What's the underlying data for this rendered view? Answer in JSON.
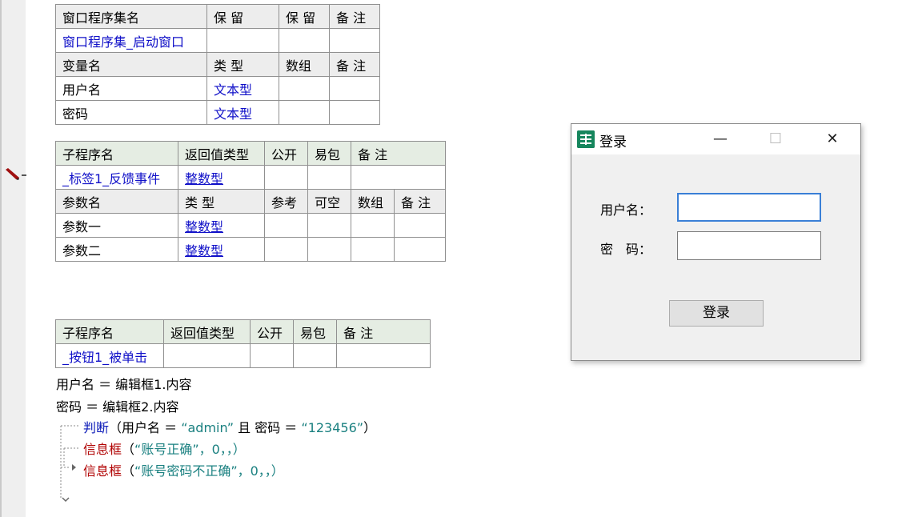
{
  "table1": {
    "header1": [
      "窗口程序集名",
      "保 留",
      "保 留",
      "备 注"
    ],
    "row1": [
      "窗口程序集_启动窗口",
      "",
      "",
      ""
    ],
    "header2": [
      "变量名",
      "类 型",
      "数组",
      "备 注"
    ],
    "vars": [
      [
        "用户名",
        "文本型",
        "",
        ""
      ],
      [
        "密码",
        "文本型",
        "",
        ""
      ]
    ]
  },
  "table2": {
    "header1": [
      "子程序名",
      "返回值类型",
      "公开",
      "易包",
      "备 注"
    ],
    "row1": [
      "_标签1_反馈事件",
      "整数型",
      "",
      "",
      ""
    ],
    "header2": [
      "参数名",
      "类 型",
      "参考",
      "可空",
      "数组",
      "备 注"
    ],
    "params": [
      [
        "参数一",
        "整数型",
        "",
        "",
        "",
        ""
      ],
      [
        "参数二",
        "整数型",
        "",
        "",
        "",
        ""
      ]
    ]
  },
  "table3": {
    "header1": [
      "子程序名",
      "返回值类型",
      "公开",
      "易包",
      "备 注"
    ],
    "row1": [
      "_按钮1_被单击",
      "",
      "",
      "",
      ""
    ]
  },
  "code": {
    "line1": "用户名 ＝ 编辑框1.内容",
    "line2": "密码 ＝ 编辑框2.内容",
    "if_kw": "判断",
    "if_cond_a": "（用户名 ＝ ",
    "if_str1": "“admin”",
    "if_cond_b": " 且 密码 ＝ ",
    "if_str2": "“123456”",
    "if_close": "）",
    "msg1_kw": "信息框",
    "msg1_open": "（",
    "msg1_str": "“账号正确”",
    "msg1_rest": "，0，，）",
    "msg2_kw": "信息框",
    "msg2_open": "（",
    "msg2_str": "“账号密码不正确”",
    "msg2_rest": "，0，，）"
  },
  "dialog": {
    "title": "登录",
    "minimize": "—",
    "maximize": "☐",
    "close": "✕",
    "username_label": "用户名：",
    "password_label": "密　码：",
    "login_button": "登录",
    "username_value": "",
    "password_value": ""
  },
  "colors": {
    "keyword_blue": "#0b1ab8",
    "keyword_red": "#b00000",
    "string_teal": "#1a8080",
    "type_blue": "#1010c8",
    "header_gray": "#ededed",
    "header_green": "#e5ede3",
    "icon_green": "#16865d"
  }
}
